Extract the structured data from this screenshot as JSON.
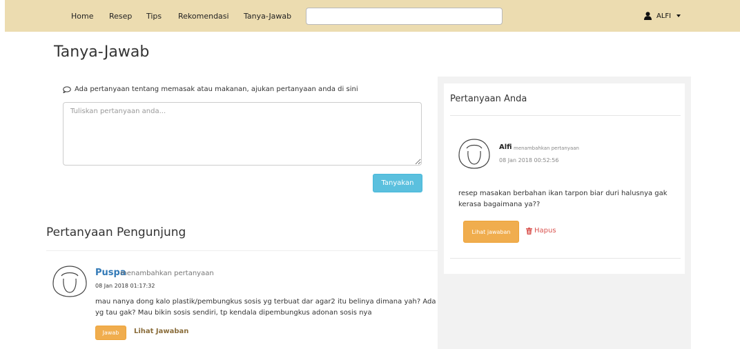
{
  "nav": {
    "items": [
      {
        "label": "Home"
      },
      {
        "label": "Resep"
      },
      {
        "label": "Tips"
      },
      {
        "label": "Rekomendasi"
      },
      {
        "label": "Tanya-Jawab"
      }
    ],
    "search": {
      "value": "",
      "placeholder": ""
    },
    "user": {
      "name": "ALFI",
      "icon": "user-icon"
    }
  },
  "page": {
    "title": "Tanya-Jawab"
  },
  "ask": {
    "prompt": "Ada pertanyaan tentang memasak atau makanan, ajukan pertanyaan anda di sini",
    "prompt_icon": "comment-icon",
    "placeholder": "Tuliskan pertanyaan anda...",
    "button_label": "Tanyakan"
  },
  "visitors": {
    "title": "Pertanyaan Pengunjung",
    "items": [
      {
        "user": "Puspa",
        "action": "menambahkan pertanyaan",
        "time": "08 Jan 2018 01:17:32",
        "text": "mau nanya dong kalo plastik/pembungkus sosis yg terbuat dar agar2 itu belinya dimana yah? Ada yg tau gak? Mau bikin sosis sendiri, tp kendala dipembungkus adonan sosis nya",
        "answer_label": "Jawab",
        "view_label": "Lihat Jawaban"
      }
    ]
  },
  "yours": {
    "title": "Pertanyaan Anda",
    "items": [
      {
        "user": "Alfi",
        "action": "menambahkan pertanyaan",
        "time": "08 Jan 2018 00:52:56",
        "text": "resep masakan berbahan ikan tarpon biar duri halusnya gak kerasa bagaimana ya??",
        "view_label": "Lihat jawaban",
        "delete_label": "Hapus",
        "delete_icon": "trash-icon"
      }
    ]
  },
  "colors": {
    "navbar": "#ecdcb0",
    "info_button": "#5bc0de",
    "warning_button": "#f0ad4e",
    "link": "#337ab7",
    "danger": "#d9534f"
  }
}
